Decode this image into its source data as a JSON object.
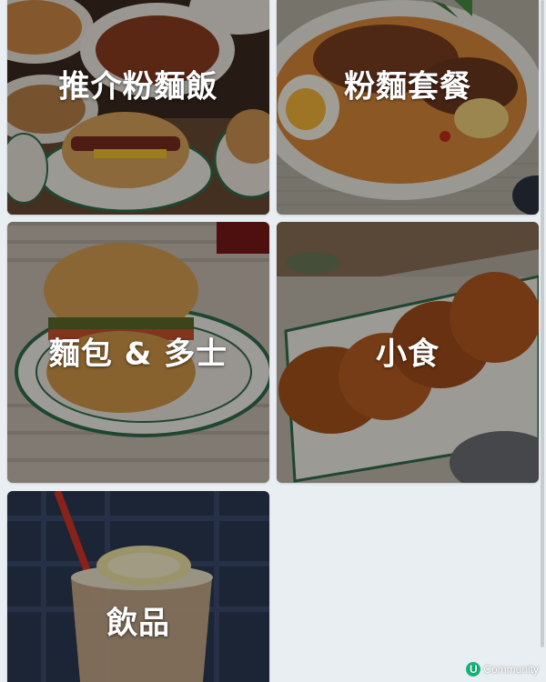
{
  "categories": [
    {
      "label": "推介粉麵飯"
    },
    {
      "label": "粉麵套餐"
    },
    {
      "label": "麵包 & 多士"
    },
    {
      "label": "小食"
    },
    {
      "label": "飲品"
    }
  ],
  "watermark": {
    "badge": "U",
    "text": "Community"
  },
  "colors": {
    "page_background": "#e9eef2",
    "label_text": "#ffffff",
    "badge_green": "#11b879"
  },
  "icons": [
    "u-community-logo-icon"
  ]
}
